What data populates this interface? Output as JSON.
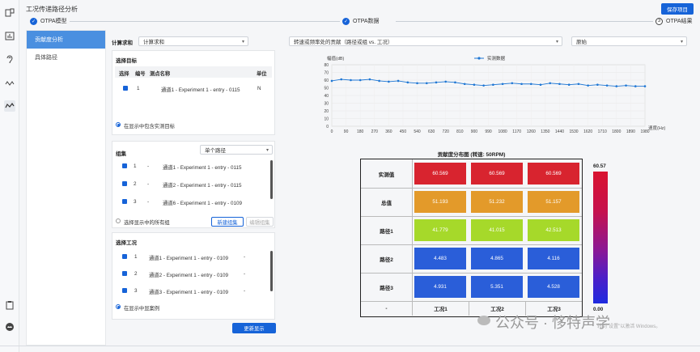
{
  "app": {
    "title": "工况传递路径分析",
    "save_label": "保存项目"
  },
  "rail": {
    "icons": [
      "layout-icon",
      "chart-icon",
      "ear-icon",
      "wave-icon",
      "wave-active-icon",
      "clipboard-icon",
      "cloud-icon"
    ]
  },
  "steps": [
    {
      "label": "OTPA模型",
      "marker": "✓"
    },
    {
      "label": "OTPA数据",
      "marker": "✓"
    },
    {
      "label": "OTPA结果",
      "marker": "3"
    }
  ],
  "subnav": {
    "items": [
      {
        "label": "贡献度分析"
      },
      {
        "label": "具体路径"
      }
    ]
  },
  "config": {
    "calc_label": "计算求和",
    "calc_value": "计算求和",
    "target_title": "选择目标",
    "target_headers": {
      "select": "选择",
      "num": "编号",
      "name": "测点名称",
      "unit": "单位"
    },
    "target_rows": [
      {
        "num": "1",
        "name": "通道1 - Experiment 1 - entry - 0115",
        "unit": "N"
      }
    ],
    "target_radio": "在显示中包含实测目标",
    "group_title": "组集",
    "group_select": "单个路径",
    "group_rows": [
      {
        "num": "1",
        "dash": "-",
        "name": "通道1 - Experiment 1 - entry - 0115"
      },
      {
        "num": "2",
        "dash": "-",
        "name": "通道2 - Experiment 1 - entry - 0115"
      },
      {
        "num": "3",
        "dash": "-",
        "name": "通道6 - Experiment 1 - entry - 0109"
      }
    ],
    "group_radio": "选择显示中的所有组",
    "new_group": "新建组集",
    "edit_group": "编辑组集",
    "case_title": "选择工况",
    "case_rows": [
      {
        "num": "1",
        "name": "通道1 - Experiment 1 - entry - 0109",
        "dash": "-"
      },
      {
        "num": "2",
        "name": "通道2 - Experiment 1 - entry - 0109",
        "dash": "-"
      },
      {
        "num": "3",
        "name": "通道3 - Experiment 1 - entry - 0109",
        "dash": "-"
      }
    ],
    "case_radio": "在显示中显案例",
    "update_label": "更新显示"
  },
  "result": {
    "chart_select": "转速或频率处的贡献（路径或组 vs. 工况）",
    "mode_select": "原始",
    "heat_title": "贡献度分布图 (转速: 50RPM)",
    "colorbar_max": "60.57",
    "colorbar_min": "0.00"
  },
  "chart_data": [
    {
      "type": "line",
      "ylabel": "幅值(dB)",
      "xlabel": "速度(Hz)",
      "legend": "实测数据",
      "legend_position": "top-center",
      "xlim": [
        0,
        1980
      ],
      "ylim": [
        0,
        80
      ],
      "xticks": [
        0,
        90,
        180,
        270,
        360,
        450,
        540,
        630,
        720,
        810,
        900,
        990,
        1080,
        1170,
        1260,
        1350,
        1440,
        1530,
        1620,
        1710,
        1800,
        1890,
        1980
      ],
      "yticks": [
        0,
        10,
        20,
        30,
        40,
        50,
        60,
        70,
        80
      ],
      "grid": true,
      "series": [
        {
          "name": "实测数据",
          "color": "#1f77d4",
          "x": [
            0,
            60,
            120,
            180,
            240,
            300,
            360,
            420,
            480,
            540,
            600,
            660,
            720,
            780,
            840,
            900,
            960,
            1020,
            1080,
            1140,
            1200,
            1260,
            1320,
            1380,
            1440,
            1500,
            1560,
            1620,
            1680,
            1740,
            1800,
            1860,
            1920,
            1980
          ],
          "values": [
            59,
            61,
            60,
            60,
            61,
            59,
            58,
            59,
            57,
            56,
            56,
            57,
            58,
            57,
            55,
            54,
            53,
            54,
            55,
            56,
            55,
            55,
            54,
            56,
            55,
            54,
            55,
            53,
            54,
            53,
            52,
            53,
            52,
            52
          ]
        }
      ]
    },
    {
      "type": "heatmap",
      "title": "贡献度分布图 (转速: 50RPM)",
      "rows": [
        "实测值",
        "总值",
        "路径1",
        "路径2",
        "路径3"
      ],
      "columns": [
        "工况1",
        "工况2",
        "工况3"
      ],
      "corner": "-",
      "values": [
        [
          "60.569",
          "60.569",
          "60.569"
        ],
        [
          "51.193",
          "51.232",
          "51.157"
        ],
        [
          "41.779",
          "41.015",
          "42.513"
        ],
        [
          "4.483",
          "4.865",
          "4.116"
        ],
        [
          "4.931",
          "5.351",
          "4.528"
        ]
      ],
      "colors": [
        [
          "#d8242f",
          "#d8242f",
          "#d8242f"
        ],
        [
          "#e39a2a",
          "#e39a2a",
          "#e39a2a"
        ],
        [
          "#a6d92a",
          "#a6d92a",
          "#a6d92a"
        ],
        [
          "#2a5ed9",
          "#2a5ed9",
          "#2a5ed9"
        ],
        [
          "#2a5ed9",
          "#2a5ed9",
          "#2a5ed9"
        ]
      ],
      "colorbar_range": [
        0,
        60.57
      ]
    }
  ],
  "watermark": {
    "text": "公众号 · 恀特声学",
    "activation": "转到\"设置\"以激活 Windows。"
  }
}
